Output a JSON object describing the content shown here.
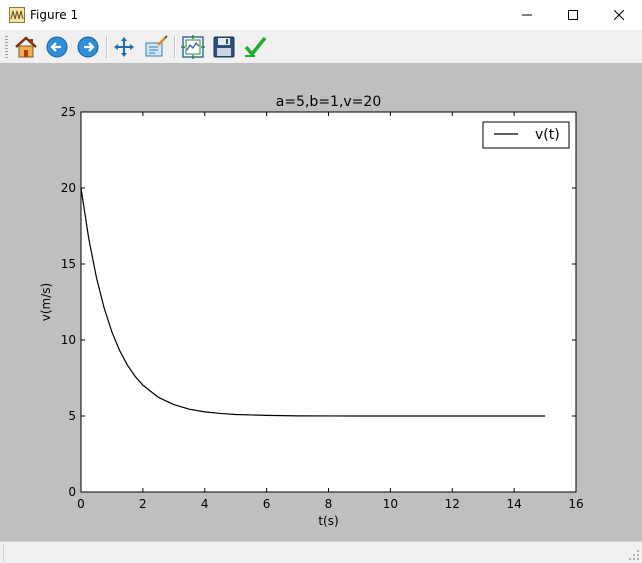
{
  "window": {
    "title": "Figure 1",
    "icon": "matplotlib-figure-icon"
  },
  "toolbar": {
    "buttons": [
      {
        "name": "home",
        "icon": "home-icon"
      },
      {
        "name": "back",
        "icon": "back-arrow-icon"
      },
      {
        "name": "forward",
        "icon": "forward-arrow-icon"
      },
      {
        "name": "pan",
        "icon": "pan-move-icon"
      },
      {
        "name": "zoom",
        "icon": "zoom-rect-icon"
      },
      {
        "name": "subplots",
        "icon": "subplots-config-icon"
      },
      {
        "name": "save",
        "icon": "save-floppy-icon"
      },
      {
        "name": "edit",
        "icon": "edit-check-icon"
      }
    ]
  },
  "colors": {
    "figure_bg": "#bfbfbf",
    "axes_bg": "#ffffff",
    "line": "#000000"
  },
  "chart_data": {
    "type": "line",
    "title": "a=5,b=1,v=20",
    "xlabel": "t(s)",
    "ylabel": "v(m/s)",
    "xlim": [
      0,
      16
    ],
    "ylim": [
      0,
      25
    ],
    "xticks": [
      0,
      2,
      4,
      6,
      8,
      10,
      12,
      14,
      16
    ],
    "yticks": [
      0,
      5,
      10,
      15,
      20,
      25
    ],
    "grid": false,
    "legend_position": "top-right",
    "series": [
      {
        "name": "v(t)",
        "color": "#000000",
        "x": [
          0,
          0.25,
          0.5,
          0.75,
          1,
          1.25,
          1.5,
          1.75,
          2,
          2.5,
          3,
          3.5,
          4,
          4.5,
          5,
          6,
          7,
          8,
          9,
          10,
          11,
          12,
          13,
          14,
          15
        ],
        "y": [
          20,
          16.68,
          14.1,
          12.09,
          10.52,
          9.3,
          8.35,
          7.61,
          7.03,
          6.23,
          5.75,
          5.45,
          5.27,
          5.17,
          5.1,
          5.04,
          5.01,
          5.005,
          5.002,
          5.001,
          5.0,
          5.0,
          5.0,
          5.0,
          5.0
        ]
      }
    ]
  }
}
